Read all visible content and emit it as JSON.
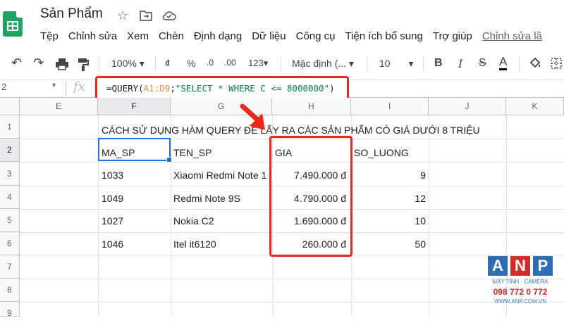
{
  "app": {
    "title": "Sản Phẩm"
  },
  "menu": [
    "Tệp",
    "Chỉnh sửa",
    "Xem",
    "Chèn",
    "Định dạng",
    "Dữ liệu",
    "Công cụ",
    "Tiện ích bổ sung",
    "Trợ giúp"
  ],
  "menu_last_edit": "Chỉnh sửa lầ",
  "toolbar": {
    "zoom": "100%",
    "currency": "₫",
    "percent": "%",
    "dec_decrease": ".0",
    "dec_increase": ".00",
    "more_formats": "123▾",
    "font": "Mặc định (...",
    "font_size": "10",
    "bold": "B",
    "italic": "I",
    "strike": "S",
    "text_color": "A"
  },
  "formula_bar": {
    "name_box": "2",
    "fx": "fx",
    "formula_prefix": "=QUERY(",
    "formula_range": "A1:D9",
    "formula_sep": ";",
    "formula_string": "\"SELECT * WHERE C <= 8000000\"",
    "formula_suffix": ")"
  },
  "columns": [
    "E",
    "F",
    "G",
    "H",
    "I",
    "J",
    "K"
  ],
  "rows": [
    "1",
    "2",
    "3",
    "4",
    "5",
    "6",
    "7",
    "8",
    "9"
  ],
  "sheet": {
    "heading": "CÁCH SỬ DỤNG HÀM QUERY ĐỂ LẤY RA CÁC SẢN PHẨM CÓ GIÁ DƯỚI 8 TRIỆU",
    "headers": {
      "ma_sp": "MA_SP",
      "ten_sp": "TEN_SP",
      "gia": "GIA",
      "so_luong": "SO_LUONG"
    },
    "data": [
      {
        "ma_sp": "1033",
        "ten_sp": "Xiaomi Redmi Note 1",
        "gia": "7.490.000 đ",
        "so_luong": "9"
      },
      {
        "ma_sp": "1049",
        "ten_sp": "Redmi Note 9S",
        "gia": "4.790.000 đ",
        "so_luong": "12"
      },
      {
        "ma_sp": "1027",
        "ten_sp": "Nokia C2",
        "gia": "1.690.000 đ",
        "so_luong": "10"
      },
      {
        "ma_sp": "1046",
        "ten_sp": "Itel it6120",
        "gia": "260.000 đ",
        "so_luong": "50"
      }
    ]
  },
  "watermark": {
    "letters": [
      "A",
      "N",
      "P"
    ],
    "subtitle": "MÁY TÍNH · CAMERA",
    "phone": "098 772 0 772",
    "website": "WWW.ANP.COM.VN",
    "colors": [
      "#2f6db5",
      "#d42b2b",
      "#2f6db5"
    ]
  },
  "colors": {
    "accent": "#1a73e8",
    "highlight": "#e8291c",
    "sheets_green": "#1fa463"
  }
}
